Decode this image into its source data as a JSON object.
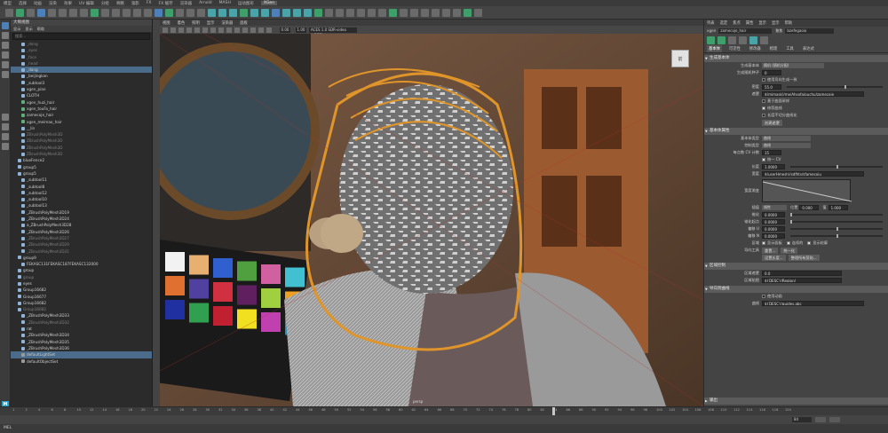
{
  "menubar": {
    "items": [
      "模型",
      "选择",
      "动画",
      "渲染",
      "效果",
      "UV 编辑",
      "分组",
      "骨骼",
      "鬼影",
      "FX",
      "FX 缓存",
      "渲染器",
      "Arnold",
      "MASH",
      "运动图形",
      "XGen"
    ],
    "active_index": 15
  },
  "outliner": {
    "title": "大纲视图",
    "menu": [
      "显示",
      "显示",
      "帮助"
    ],
    "search_placeholder": "搜索...",
    "rows": [
      {
        "label": "_dong",
        "type": "mesh",
        "dim": true
      },
      {
        "label": "_eyes",
        "type": "mesh",
        "dim": true
      },
      {
        "label": "_face",
        "type": "mesh",
        "dim": true
      },
      {
        "label": "_head",
        "type": "mesh",
        "dim": true
      },
      {
        "label": "_dang",
        "type": "mesh",
        "dim": false,
        "selected": true
      },
      {
        "label": "_beijingkan",
        "type": "mesh",
        "dim": false
      },
      {
        "label": "_subtool3",
        "type": "mesh",
        "dim": false
      },
      {
        "label": "xgen_pian",
        "type": "mesh",
        "dim": false
      },
      {
        "label": "CLOTH",
        "type": "mesh",
        "dim": false
      },
      {
        "label": "xgen_huzi_hair",
        "type": "xgen",
        "dim": false
      },
      {
        "label": "xgen_touFa_hair",
        "type": "xgen",
        "dim": false
      },
      {
        "label": "zamecoje_hair",
        "type": "xgen",
        "dim": false
      },
      {
        "label": "xgen_meimao_hair",
        "type": "xgen",
        "dim": false
      },
      {
        "label": "__lin",
        "type": "mesh",
        "dim": false
      },
      {
        "label": "ZBrushPolyMesh3D",
        "type": "mesh",
        "dim": true
      },
      {
        "label": "ZBrushPolyMesh3D",
        "type": "mesh",
        "dim": true
      },
      {
        "label": "ZBrushPolyMesh3D",
        "type": "mesh",
        "dim": true
      },
      {
        "label": "ZBrushPolyMesh3D",
        "type": "mesh",
        "dim": true
      },
      {
        "label": "blueFence2",
        "type": "group",
        "dim": false
      },
      {
        "label": "group5",
        "type": "group",
        "dim": false
      },
      {
        "label": "group5",
        "type": "group",
        "dim": false
      },
      {
        "label": "_subtool11",
        "type": "mesh",
        "dim": false
      },
      {
        "label": "_subtool8",
        "type": "mesh",
        "dim": false
      },
      {
        "label": "_subtool12",
        "type": "mesh",
        "dim": false
      },
      {
        "label": "_subtool10",
        "type": "mesh",
        "dim": false
      },
      {
        "label": "_subtool13",
        "type": "mesh",
        "dim": false
      },
      {
        "label": "_ZBrushPolyMesh3D19",
        "type": "mesh",
        "dim": false
      },
      {
        "label": "_ZBrushPolyMesh3D24",
        "type": "mesh",
        "dim": false
      },
      {
        "label": "a_ZBrushPolyMesh3D28",
        "type": "mesh",
        "dim": false
      },
      {
        "label": "_ZBrushPolyMesh3D26",
        "type": "mesh",
        "dim": false
      },
      {
        "label": "_ZBrushPolyMesh3D27",
        "type": "mesh",
        "dim": true
      },
      {
        "label": "_ZBrushPolyMesh3D29",
        "type": "mesh",
        "dim": true
      },
      {
        "label": "_ZBrushPolyMesh3D31",
        "type": "mesh",
        "dim": true
      },
      {
        "label": "group9",
        "type": "group",
        "dim": false
      },
      {
        "label": "FEKASC131FEKASC187FEKASC132000",
        "type": "mesh",
        "dim": false
      },
      {
        "label": "group",
        "type": "group",
        "dim": false
      },
      {
        "label": "group",
        "type": "group",
        "dim": true
      },
      {
        "label": "eyes",
        "type": "group",
        "dim": false
      },
      {
        "label": "Group16682",
        "type": "group",
        "dim": false
      },
      {
        "label": "Group16677",
        "type": "group",
        "dim": false
      },
      {
        "label": "Group16682",
        "type": "group",
        "dim": false
      },
      {
        "label": "Group16682",
        "type": "group",
        "dim": true
      },
      {
        "label": "_ZBrushPolyMesh3D33",
        "type": "mesh",
        "dim": false
      },
      {
        "label": "_ZBrushPolyMesh3D32",
        "type": "mesh",
        "dim": true
      },
      {
        "label": "rat",
        "type": "mesh",
        "dim": false
      },
      {
        "label": "_ZBrushPolyMesh3D34",
        "type": "mesh",
        "dim": false
      },
      {
        "label": "_ZBrushPolyMesh3D35",
        "type": "mesh",
        "dim": false
      },
      {
        "label": "_ZBrushPolyMesh3D36",
        "type": "mesh",
        "dim": false
      },
      {
        "label": "defaultLightSet",
        "type": "set",
        "dim": false,
        "selected": true
      },
      {
        "label": "defaultObjectSet",
        "type": "set",
        "dim": false
      }
    ]
  },
  "viewport": {
    "menu": [
      "视图",
      "着色",
      "照明",
      "显示",
      "渲染器",
      "面板"
    ],
    "gamma": "1.00",
    "exposure": "0.00",
    "colorspace": "ACES 1.0 SDR-video (sRGB)",
    "camera_label": "persp",
    "viewcube_label": "前"
  },
  "attr": {
    "menu": [
      "列表",
      "选定",
      "焦点",
      "属性",
      "显示",
      "显示",
      "帮助"
    ],
    "node_label": "xgen",
    "node_value": "zamecoje_hair",
    "focus_label": "聚焦",
    "focus_value": "bzefegaoio",
    "tabs": [
      "基本体",
      "可见性",
      "修改器",
      "梳理",
      "工具",
      "表达式"
    ],
    "section1": "生成基本体",
    "gen_mode_label": "生成基本体",
    "gen_mode_value": "随机 (随机分配)",
    "gen_seed_label": "生成随机种子",
    "gen_seed_value": "0",
    "dense_check_label": "使用导向生成一致",
    "density_label": "密度",
    "density_value": "55.0",
    "mask_label": "遮罩",
    "mask_value": "$(mimask)/meiAhsofa/puchu/zamecoje",
    "opt1": "基于曲面采样",
    "opt2": "修剪曲线",
    "opt3": "长度不切分曲线化",
    "button1": "创建遮罩",
    "section2": "基本体属性",
    "prim_type_label": "基本体类型",
    "prim_type_value": "曲线",
    "taper_label": "控制类型",
    "taper_value": "曲线",
    "cv_label": "每点数 CV 计数",
    "cv_value": "15",
    "cv_check_label": "统一 CV",
    "length_label": "长度",
    "length_value": "1.0000",
    "width_map_label": "宽度",
    "width_map_value": "$(userHmesh)/sdfhts/sfamecoju",
    "width_ramp_label": "宽度渐变",
    "interp_label": "插值",
    "interp_value": "线性",
    "pos_label": "位置",
    "pos_value": "0.000",
    "val_label": "值",
    "val_value": "1.000",
    "taper_s_label": "锥化",
    "taper_s_value": "0.0000",
    "taper_start_label": "锥化起点",
    "taper_start_value": "0.0000",
    "offset_label": "偏移 U",
    "offset_value": "0.0000",
    "offset2_label": "偏移 N",
    "offset2_value": "0.0000",
    "region_label": "区域",
    "region_cb1": "显示面板",
    "region_cb2": "连续的",
    "region_cb3": "显示轮廓",
    "guides_label": "导向工具",
    "guides_btn1": "重置...",
    "guides_btn2": "统一化",
    "btn_set": "设置长度...",
    "btn_clean": "整理所有剪贴...",
    "section3": "区域控制",
    "region_mask_label": "区域遮罩",
    "region_mask_value": "0.0",
    "region_map_label": "区域贴图",
    "region_map_value": "${DESC}/Region/",
    "section4": "导向到曲线",
    "guide_check": "使用动画",
    "guide_path_label": "曲线",
    "guide_path_value": "${DESC}/guides.abc",
    "section5": "输出"
  },
  "timeline": {
    "ticks": [
      "1",
      "2",
      "4",
      "6",
      "8",
      "10",
      "12",
      "14",
      "16",
      "18",
      "20",
      "22",
      "24",
      "26",
      "28",
      "30",
      "32",
      "34",
      "36",
      "38",
      "40",
      "42",
      "44",
      "46",
      "48",
      "50",
      "52",
      "54",
      "56",
      "58",
      "60",
      "62",
      "64",
      "66",
      "68",
      "70",
      "72",
      "74",
      "76",
      "78",
      "80",
      "82",
      "84",
      "86",
      "88",
      "90",
      "92",
      "94",
      "96",
      "98",
      "100",
      "102",
      "104",
      "106",
      "108",
      "110",
      "112",
      "114",
      "116",
      "118",
      "120"
    ],
    "current_frame": "84",
    "end_frame": "120"
  },
  "cmdline": {
    "lang": "MEL",
    "logo": "M"
  },
  "colors": {
    "accent": "#4d7fb8",
    "hair": "#e0952a",
    "xgen_icon": "#3f9f6a"
  }
}
